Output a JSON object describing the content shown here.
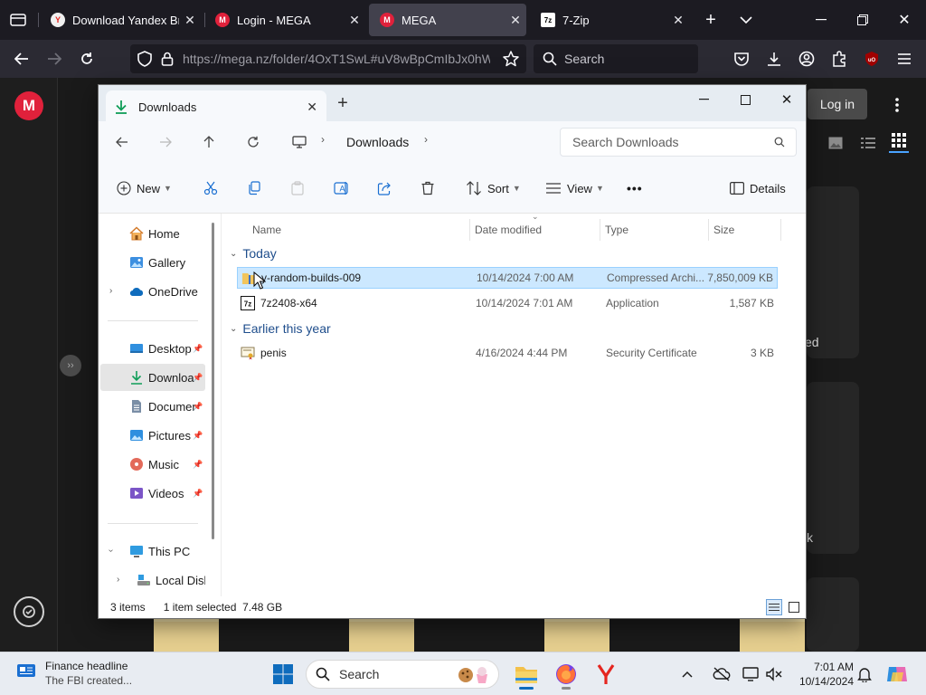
{
  "browser": {
    "tabs": [
      {
        "title": "Download Yandex Brow",
        "favicon": "yandex-icon"
      },
      {
        "title": "Login - MEGA",
        "favicon": "mega-icon"
      },
      {
        "title": "MEGA",
        "favicon": "mega-icon",
        "active": true
      },
      {
        "title": "7-Zip",
        "favicon": "7zip-icon"
      }
    ],
    "url": "https://mega.nz/folder/4OxT1SwL#uV8wBpCmIbJx0hW",
    "search_placeholder": "Search"
  },
  "mega": {
    "login_label": "Log in",
    "card_fragment_1": "ed",
    "card_fragment_2": "k",
    "accent": "#e0213b"
  },
  "explorer": {
    "tab_title": "Downloads",
    "breadcrumb": [
      "Downloads"
    ],
    "search_placeholder": "Search Downloads",
    "commands": {
      "new": "New",
      "sort": "Sort",
      "view": "View",
      "more": "•••",
      "details": "Details"
    },
    "nav": {
      "home": "Home",
      "gallery": "Gallery",
      "onedrive": "OneDrive",
      "desktop": "Desktop",
      "downloads": "Downloa",
      "documents": "Documer",
      "pictures": "Pictures",
      "music": "Music",
      "videos": "Videos",
      "thispc": "This PC",
      "localdisk": "Local Disk"
    },
    "columns": {
      "name": "Name",
      "date": "Date modified",
      "type": "Type",
      "size": "Size"
    },
    "groups": {
      "today": {
        "label": "Today",
        "rows": [
          {
            "name": "y-random-builds-009",
            "date": "10/14/2024 7:00 AM",
            "type": "Compressed Archi...",
            "size": "7,850,009 KB"
          },
          {
            "name": "7z2408-x64",
            "date": "10/14/2024 7:01 AM",
            "type": "Application",
            "size": "1,587 KB"
          }
        ]
      },
      "earlier": {
        "label": "Earlier this year",
        "rows": [
          {
            "name": "penis",
            "date": "4/16/2024 4:44 PM",
            "type": "Security Certificate",
            "size": "3 KB"
          }
        ]
      }
    },
    "status": {
      "items": "3 items",
      "selected": "1 item selected  7.48 GB"
    }
  },
  "taskbar": {
    "news_title": "Finance headline",
    "news_sub": "The FBI created...",
    "search_label": "Search",
    "time": "7:01 AM",
    "date": "10/14/2024"
  }
}
